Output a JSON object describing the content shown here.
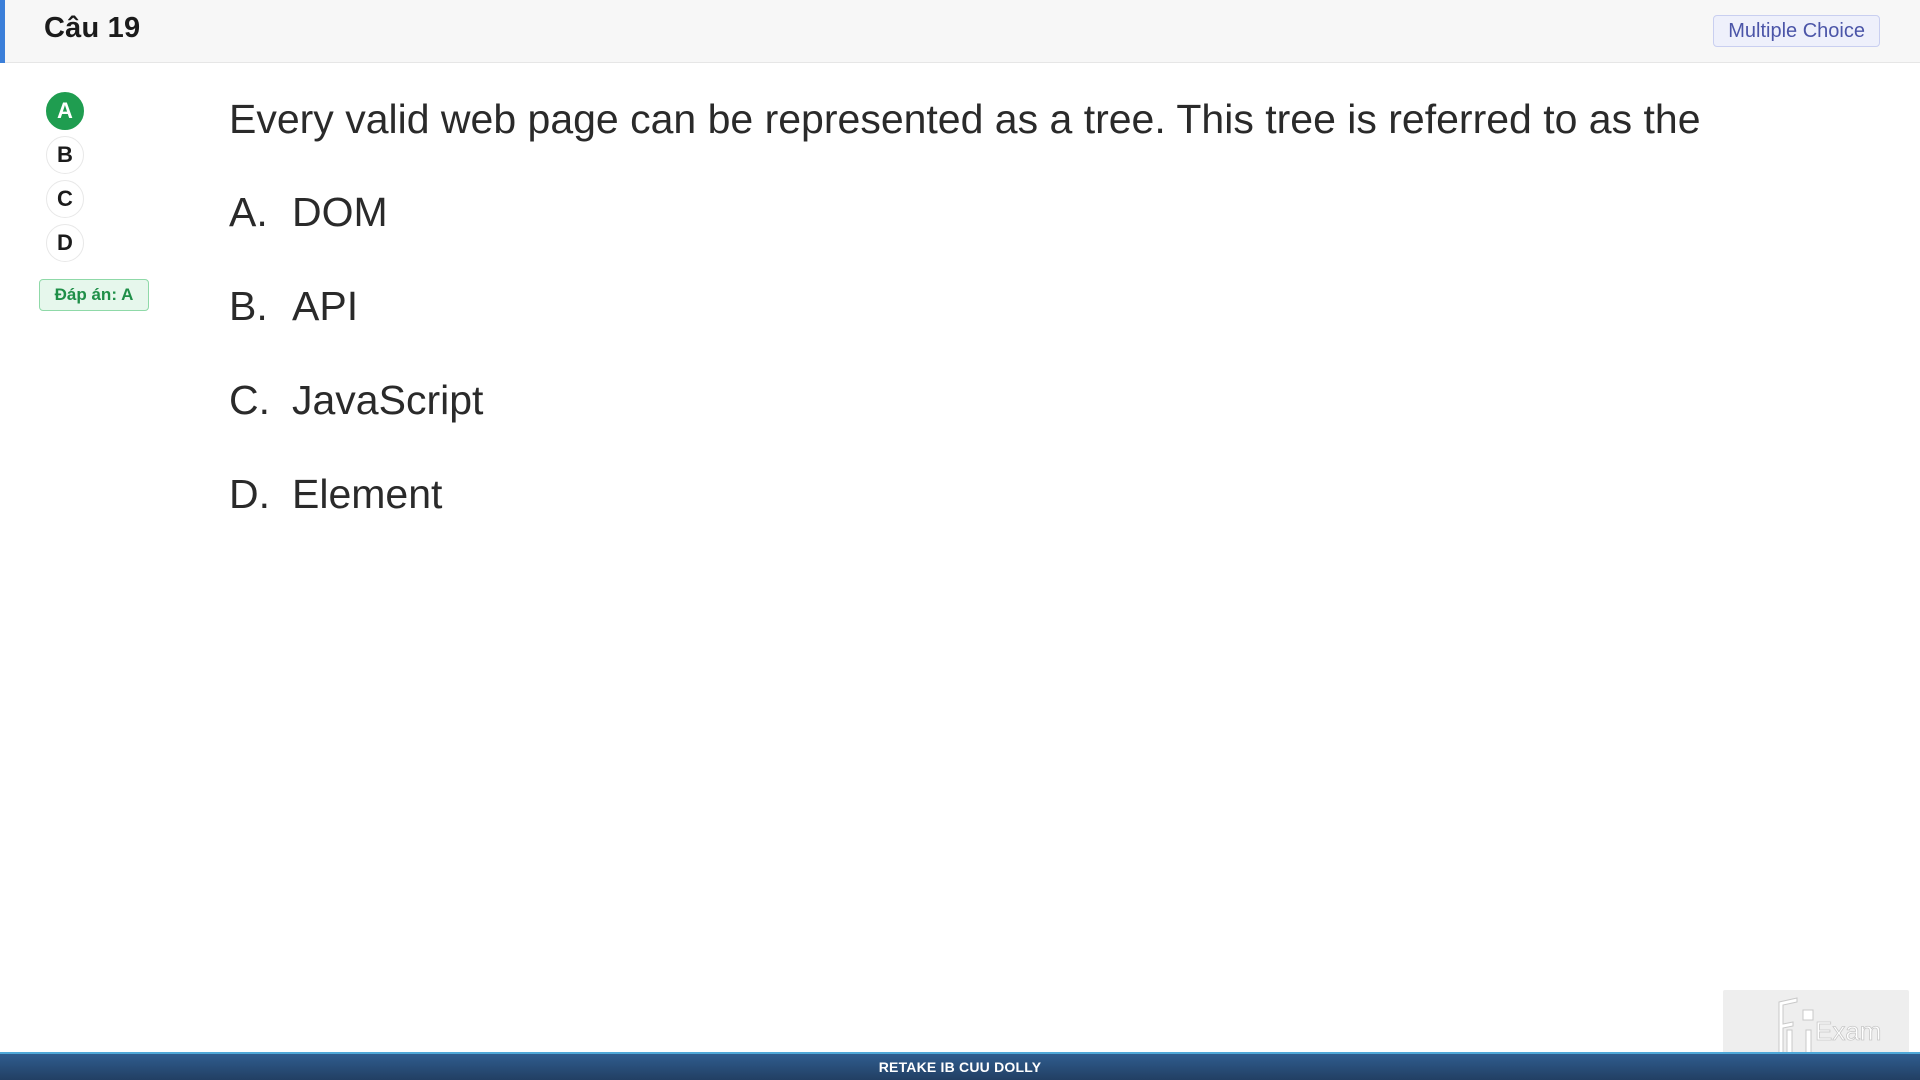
{
  "header": {
    "title": "Câu 19",
    "type_badge": "Multiple Choice"
  },
  "picker": {
    "options": [
      "A",
      "B",
      "C",
      "D"
    ],
    "selected": "A"
  },
  "answer_badge": "Đáp án: A",
  "question": {
    "text": "Every valid web page can be represented as a tree. This tree is referred to as the",
    "options": [
      {
        "letter": "A.",
        "text": "DOM"
      },
      {
        "letter": "B.",
        "text": "API"
      },
      {
        "letter": "C.",
        "text": "JavaScript"
      },
      {
        "letter": "D.",
        "text": "Element"
      }
    ]
  },
  "footer": {
    "text": "RETAKE IB CUU DOLLY"
  },
  "colors": {
    "accent": "#3b7fd9",
    "correct": "#1f9d50",
    "footer": "#2f5d8f"
  }
}
